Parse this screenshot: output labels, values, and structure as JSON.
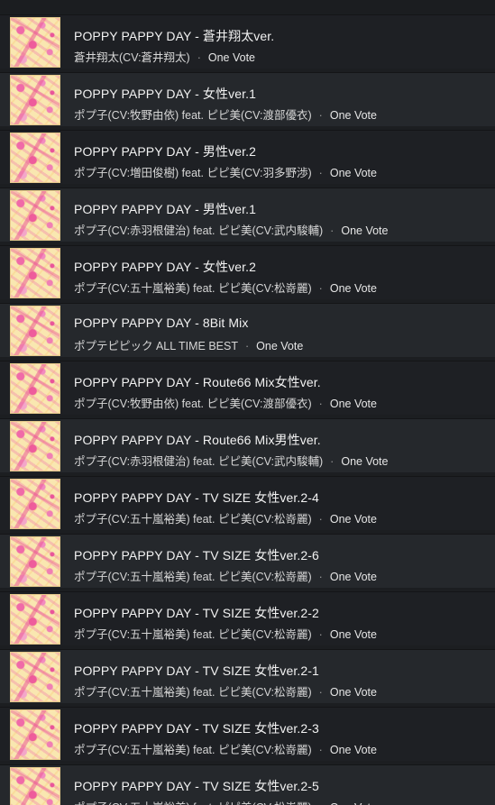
{
  "tracks": [
    {
      "title": "POPPY PAPPY DAY - 蒼井翔太ver.",
      "artist": "蒼井翔太(CV:蒼井翔太)",
      "album": "One Vote"
    },
    {
      "title": "POPPY PAPPY DAY - 女性ver.1",
      "artist": "ポプ子(CV:牧野由依) feat. ピピ美(CV:渡部優衣)",
      "album": "One Vote"
    },
    {
      "title": "POPPY PAPPY DAY - 男性ver.2",
      "artist": "ポプ子(CV:増田俊樹) feat. ピピ美(CV:羽多野渉)",
      "album": "One Vote"
    },
    {
      "title": "POPPY PAPPY DAY - 男性ver.1",
      "artist": "ポプ子(CV:赤羽根健治) feat. ピピ美(CV:武内駿輔)",
      "album": "One Vote"
    },
    {
      "title": "POPPY PAPPY DAY - 女性ver.2",
      "artist": "ポプ子(CV:五十嵐裕美) feat. ピピ美(CV:松嵜麗)",
      "album": "One Vote"
    },
    {
      "title": "POPPY PAPPY DAY - 8Bit Mix",
      "artist": "ポプテピピック ALL TIME BEST",
      "album": "One Vote"
    },
    {
      "title": "POPPY PAPPY DAY - Route66 Mix女性ver.",
      "artist": "ポプ子(CV:牧野由依) feat. ピピ美(CV:渡部優衣)",
      "album": "One Vote"
    },
    {
      "title": "POPPY PAPPY DAY - Route66 Mix男性ver.",
      "artist": "ポプ子(CV:赤羽根健治) feat. ピピ美(CV:武内駿輔)",
      "album": "One Vote"
    },
    {
      "title": "POPPY PAPPY DAY - TV SIZE 女性ver.2-4",
      "artist": "ポプ子(CV:五十嵐裕美) feat. ピピ美(CV:松嵜麗)",
      "album": "One Vote"
    },
    {
      "title": "POPPY PAPPY DAY - TV SIZE 女性ver.2-6",
      "artist": "ポプ子(CV:五十嵐裕美) feat. ピピ美(CV:松嵜麗)",
      "album": "One Vote"
    },
    {
      "title": "POPPY PAPPY DAY - TV SIZE 女性ver.2-2",
      "artist": "ポプ子(CV:五十嵐裕美) feat. ピピ美(CV:松嵜麗)",
      "album": "One Vote"
    },
    {
      "title": "POPPY PAPPY DAY - TV SIZE 女性ver.2-1",
      "artist": "ポプ子(CV:五十嵐裕美) feat. ピピ美(CV:松嵜麗)",
      "album": "One Vote"
    },
    {
      "title": "POPPY PAPPY DAY - TV SIZE 女性ver.2-3",
      "artist": "ポプ子(CV:五十嵐裕美) feat. ピピ美(CV:松嵜麗)",
      "album": "One Vote"
    },
    {
      "title": "POPPY PAPPY DAY - TV SIZE 女性ver.2-5",
      "artist": "ポプ子(CV:五十嵐裕美) feat. ピピ美(CV:松嵜麗)",
      "album": "One Vote"
    }
  ],
  "separator": "·"
}
